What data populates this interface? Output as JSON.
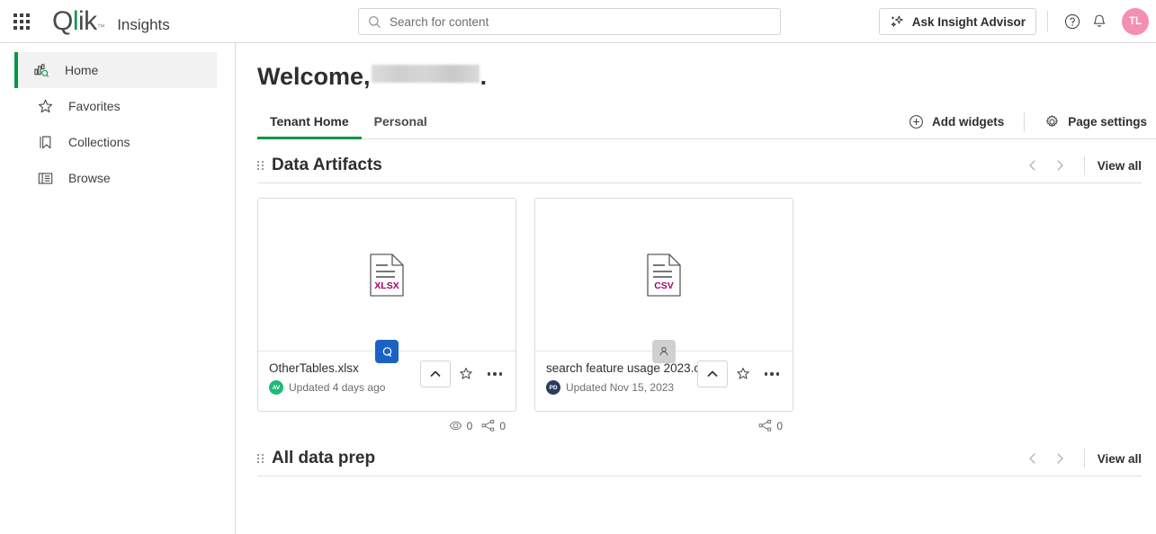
{
  "topbar": {
    "app_launcher_icon": "app-grid-icon",
    "logo_text": {
      "q": "Q",
      "l": "l",
      "ik": "ik",
      "tm": "™"
    },
    "app_title": "Insights",
    "search": {
      "placeholder": "Search for content",
      "value": "",
      "icon": "search-icon"
    },
    "advisor_button": {
      "label": "Ask Insight Advisor",
      "icon": "sparkle-icon"
    },
    "help_icon": "help-circle-icon",
    "notifications_icon": "bell-icon",
    "avatar": {
      "initials": "TL",
      "color": "#f48fb1"
    }
  },
  "sidebar": {
    "items": [
      {
        "label": "Home",
        "icon": "home-analytics-icon",
        "active": true
      },
      {
        "label": "Favorites",
        "icon": "star-icon",
        "active": false
      },
      {
        "label": "Collections",
        "icon": "bookmark-icon",
        "active": false
      },
      {
        "label": "Browse",
        "icon": "browse-columns-icon",
        "active": false
      }
    ]
  },
  "main": {
    "welcome_prefix": "Welcome,",
    "welcome_name": "",
    "welcome_suffix": ".",
    "tabs": [
      {
        "label": "Tenant Home",
        "active": true
      },
      {
        "label": "Personal",
        "active": false
      }
    ],
    "actions": [
      {
        "label": "Add widgets",
        "icon": "plus-circle-icon"
      },
      {
        "label": "Page settings",
        "icon": "gear-icon"
      }
    ],
    "sections": [
      {
        "title": "Data Artifacts",
        "view_all_label": "View all",
        "prev_icon": "chevron-left-icon",
        "next_icon": "chevron-right-icon",
        "cards": [
          {
            "name": "OtherTables.xlsx",
            "file_type": "XLSX",
            "badge": {
              "type": "app",
              "icon": "qlik-app-icon",
              "color": "#1a63c4"
            },
            "owner_initials": "AV",
            "owner_color": "#21b97a",
            "updated": "Updated 4 days ago",
            "expand_icon": "chevron-up-icon",
            "favorite_icon": "star-outline-icon",
            "more_icon": "ellipsis-icon",
            "stats": [
              {
                "icon": "eye-icon",
                "value": "0"
              },
              {
                "icon": "share-nodes-icon",
                "value": "0"
              }
            ]
          },
          {
            "name": "search feature usage 2023.csv",
            "file_type": "CSV",
            "badge": {
              "type": "user",
              "icon": "user-icon",
              "color": "#d0d0d0"
            },
            "owner_initials": "PD",
            "owner_color": "#2b3a5e",
            "updated": "Updated Nov 15, 2023",
            "expand_icon": "chevron-up-icon",
            "favorite_icon": "star-outline-icon",
            "more_icon": "ellipsis-icon",
            "stats": [
              {
                "icon": "share-nodes-icon",
                "value": "0"
              }
            ]
          }
        ]
      },
      {
        "title": "All data prep",
        "view_all_label": "View all",
        "prev_icon": "chevron-left-icon",
        "next_icon": "chevron-right-icon",
        "cards": []
      }
    ]
  },
  "colors": {
    "accent_green": "#009845",
    "file_type_magenta": "#a4006b",
    "app_blue": "#1a63c4"
  }
}
